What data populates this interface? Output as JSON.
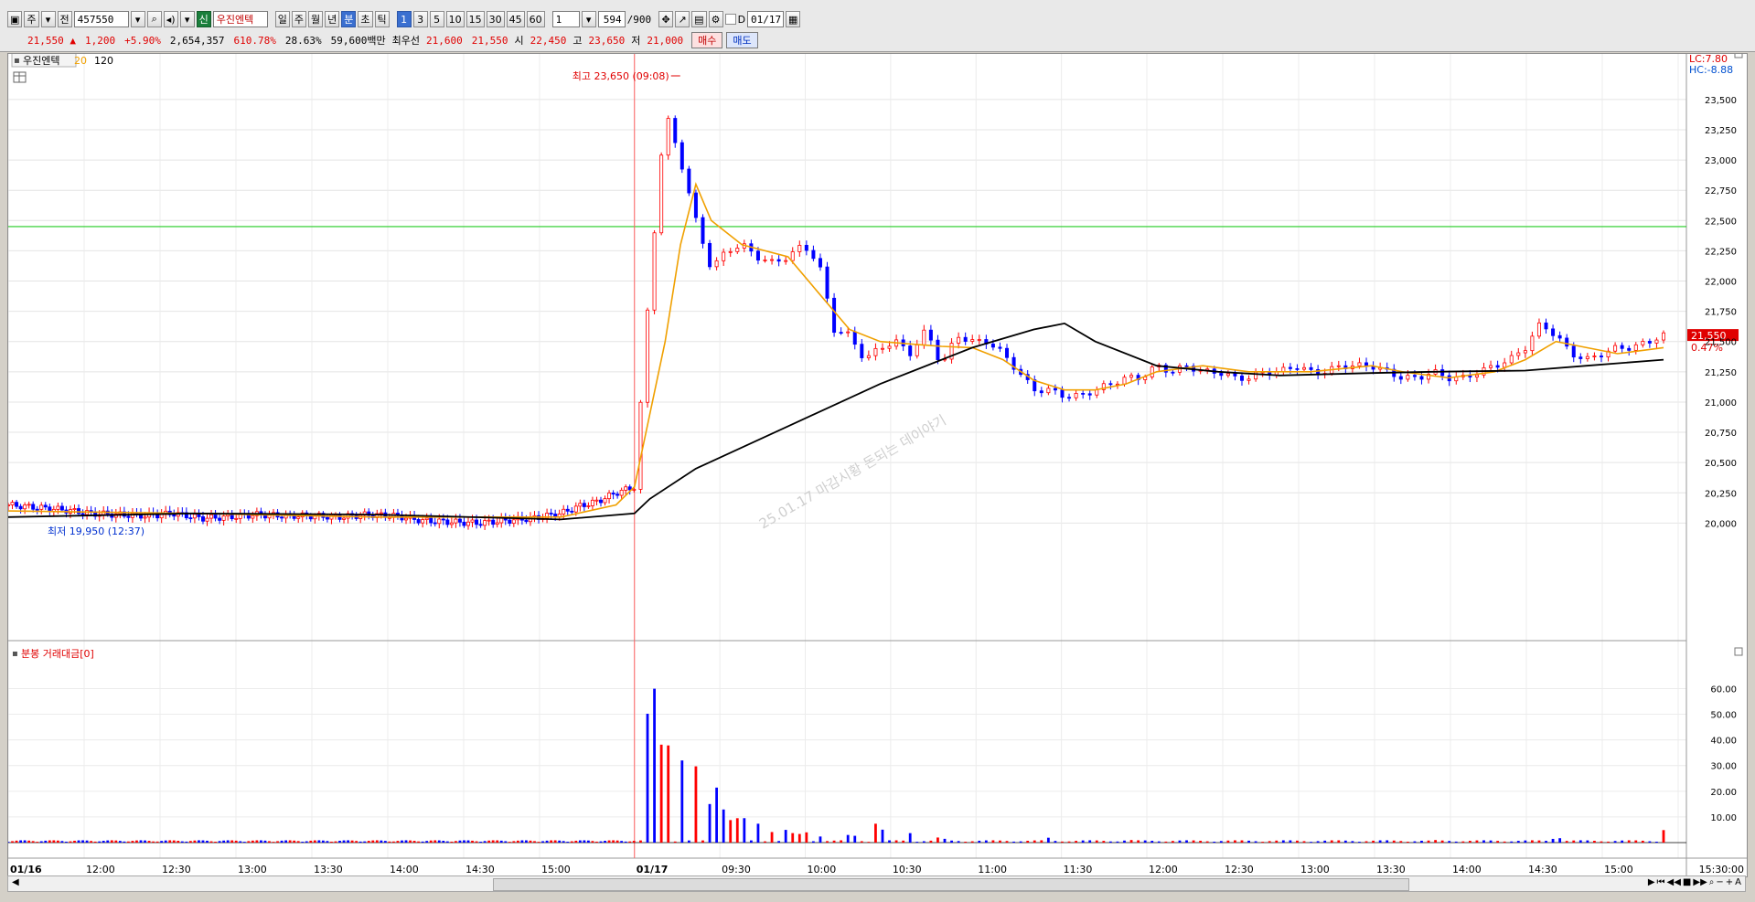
{
  "toolbar": {
    "market_label": "주",
    "mode_label": "전",
    "code": "457550",
    "new_badge": "신",
    "stock_name": "우진엔텍",
    "periods": [
      "일",
      "주",
      "월",
      "년",
      "분",
      "초",
      "틱"
    ],
    "selected_period": "분",
    "intervals": [
      "1",
      "3",
      "5",
      "10",
      "15",
      "30",
      "45",
      "60"
    ],
    "selected_interval": "1",
    "multiplier": "1",
    "count_current": "594",
    "count_total": "/900",
    "date_check_label": "D",
    "date": "01/17"
  },
  "quote": {
    "price": "21,550",
    "arrow": "▲",
    "change": "1,200",
    "change_pct": "+5.90%",
    "volume": "2,654,357",
    "volume_ratio": "610.78%",
    "turnover": "28.63%",
    "amount": "59,600백만",
    "best_label": "최우선",
    "best_ask": "21,600",
    "best_bid": "21,550",
    "open_label": "시",
    "open": "22,450",
    "high_label": "고",
    "high": "23,650",
    "low_label": "저",
    "low": "21,000",
    "buy_label": "매수",
    "sell_label": "매도"
  },
  "chart": {
    "legend_name": "우진엔텍",
    "ma_short": "20",
    "ma_long": "120",
    "lc_label": "LC:7.80",
    "hc_label": "HC:-8.88",
    "high_marker": "최고 23,650 (09:08)",
    "low_marker": "최저 19,950 (12:37)",
    "watermark": "25.01.17 마감시황 돈되는 데이야기",
    "price_tag": "21,550",
    "price_tag_pct": "0.47%",
    "volume_title": "분봉 거래대금[0]",
    "colors": {
      "up": "#ff0000",
      "down": "#0000ff",
      "ma_short": "#f0a000",
      "ma_long": "#000000",
      "hline": "#00cc00"
    }
  },
  "chart_data": {
    "type": "candlestick",
    "price_axis": {
      "ticks": [
        20000,
        20250,
        20500,
        20750,
        21000,
        21250,
        21500,
        21750,
        22000,
        22250,
        22500,
        22750,
        23000,
        23250,
        23500
      ],
      "min": 19900,
      "max": 23800
    },
    "horizontal_line": 22450,
    "time_axis": [
      "01/16",
      "12:00",
      "12:30",
      "13:00",
      "13:30",
      "14:00",
      "14:30",
      "15:00",
      "01/17",
      "09:30",
      "10:00",
      "10:30",
      "11:00",
      "11:30",
      "12:00",
      "12:30",
      "13:00",
      "13:30",
      "14:00",
      "14:30",
      "15:00",
      "15:30:00"
    ],
    "close_series": [
      [
        0,
        20150
      ],
      [
        3,
        20130
      ],
      [
        6,
        20110
      ],
      [
        9,
        20080
      ],
      [
        12,
        20070
      ],
      [
        15,
        20060
      ],
      [
        18,
        20080
      ],
      [
        21,
        20040
      ],
      [
        24,
        20050
      ],
      [
        27,
        20070
      ],
      [
        30,
        20060
      ],
      [
        33,
        20060
      ],
      [
        36,
        20050
      ],
      [
        39,
        20070
      ],
      [
        42,
        20060
      ],
      [
        45,
        20020
      ],
      [
        48,
        20010
      ],
      [
        51,
        20000
      ],
      [
        54,
        20020
      ],
      [
        57,
        20040
      ],
      [
        60,
        20080
      ],
      [
        62,
        20140
      ],
      [
        64,
        20180
      ],
      [
        66,
        20250
      ],
      [
        68,
        20300
      ],
      [
        69,
        22000
      ],
      [
        70,
        23400
      ],
      [
        71,
        23000
      ],
      [
        72,
        22500
      ],
      [
        73,
        22100
      ],
      [
        74,
        22250
      ],
      [
        75,
        22300
      ],
      [
        76,
        22200
      ],
      [
        77,
        22150
      ],
      [
        78,
        22200
      ],
      [
        79,
        22300
      ],
      [
        80,
        22150
      ],
      [
        81,
        21600
      ],
      [
        82,
        21550
      ],
      [
        83,
        21350
      ],
      [
        84,
        21450
      ],
      [
        85,
        21500
      ],
      [
        86,
        21400
      ],
      [
        87,
        21600
      ],
      [
        88,
        21300
      ],
      [
        89,
        21550
      ],
      [
        90,
        21500
      ],
      [
        91,
        21500
      ],
      [
        92,
        21400
      ],
      [
        93,
        21250
      ],
      [
        94,
        21100
      ],
      [
        95,
        21100
      ],
      [
        96,
        21050
      ],
      [
        97,
        21050
      ],
      [
        98,
        21100
      ],
      [
        99,
        21150
      ],
      [
        100,
        21200
      ],
      [
        101,
        21200
      ],
      [
        102,
        21300
      ],
      [
        103,
        21250
      ],
      [
        104,
        21300
      ],
      [
        105,
        21250
      ],
      [
        106,
        21250
      ],
      [
        107,
        21200
      ],
      [
        108,
        21200
      ],
      [
        109,
        21250
      ],
      [
        110,
        21250
      ],
      [
        111,
        21300
      ],
      [
        112,
        21250
      ],
      [
        113,
        21250
      ],
      [
        114,
        21300
      ],
      [
        115,
        21300
      ],
      [
        116,
        21300
      ],
      [
        117,
        21250
      ],
      [
        118,
        21200
      ],
      [
        119,
        21200
      ],
      [
        120,
        21250
      ],
      [
        121,
        21200
      ],
      [
        122,
        21200
      ],
      [
        123,
        21250
      ],
      [
        124,
        21300
      ],
      [
        125,
        21350
      ],
      [
        126,
        21450
      ],
      [
        127,
        21650
      ],
      [
        128,
        21550
      ],
      [
        129,
        21400
      ],
      [
        130,
        21350
      ],
      [
        131,
        21400
      ],
      [
        132,
        21450
      ],
      [
        133,
        21450
      ],
      [
        134,
        21500
      ],
      [
        135,
        21550
      ]
    ],
    "ma20_series": [
      [
        0,
        20100
      ],
      [
        20,
        20080
      ],
      [
        40,
        20050
      ],
      [
        60,
        20050
      ],
      [
        66,
        20150
      ],
      [
        68,
        20300
      ],
      [
        70,
        21500
      ],
      [
        71,
        22300
      ],
      [
        72,
        22800
      ],
      [
        73,
        22500
      ],
      [
        75,
        22300
      ],
      [
        78,
        22200
      ],
      [
        80,
        21900
      ],
      [
        82,
        21600
      ],
      [
        84,
        21500
      ],
      [
        86,
        21480
      ],
      [
        88,
        21460
      ],
      [
        90,
        21450
      ],
      [
        92,
        21350
      ],
      [
        94,
        21180
      ],
      [
        96,
        21100
      ],
      [
        98,
        21100
      ],
      [
        100,
        21150
      ],
      [
        102,
        21250
      ],
      [
        105,
        21300
      ],
      [
        108,
        21250
      ],
      [
        112,
        21250
      ],
      [
        116,
        21300
      ],
      [
        118,
        21250
      ],
      [
        121,
        21200
      ],
      [
        124,
        21250
      ],
      [
        126,
        21350
      ],
      [
        128,
        21500
      ],
      [
        130,
        21450
      ],
      [
        132,
        21400
      ],
      [
        135,
        21450
      ]
    ],
    "ma120_series": [
      [
        0,
        20050
      ],
      [
        20,
        20080
      ],
      [
        40,
        20070
      ],
      [
        60,
        20030
      ],
      [
        68,
        20080
      ],
      [
        69,
        20200
      ],
      [
        72,
        20450
      ],
      [
        78,
        20800
      ],
      [
        84,
        21150
      ],
      [
        90,
        21450
      ],
      [
        94,
        21600
      ],
      [
        96,
        21650
      ],
      [
        98,
        21500
      ],
      [
        102,
        21300
      ],
      [
        106,
        21250
      ],
      [
        110,
        21220
      ],
      [
        116,
        21240
      ],
      [
        120,
        21250
      ],
      [
        126,
        21260
      ],
      [
        130,
        21300
      ],
      [
        135,
        21350
      ]
    ],
    "volume_axis": {
      "ticks": [
        10,
        20,
        30,
        40,
        50,
        60
      ],
      "unit": "",
      "max": 68
    },
    "volume_series": [
      [
        69,
        60
      ],
      [
        70,
        48
      ],
      [
        71,
        38
      ],
      [
        72,
        30
      ],
      [
        73,
        22
      ],
      [
        74,
        14
      ],
      [
        75,
        10
      ],
      [
        76,
        8
      ],
      [
        77,
        6
      ],
      [
        78,
        5
      ],
      [
        79,
        4
      ],
      [
        80,
        3
      ],
      [
        82,
        3
      ],
      [
        84,
        8
      ],
      [
        86,
        4
      ],
      [
        88,
        2
      ],
      [
        95,
        2
      ],
      [
        100,
        1
      ],
      [
        120,
        1
      ],
      [
        128,
        2
      ],
      [
        135,
        8
      ]
    ]
  }
}
